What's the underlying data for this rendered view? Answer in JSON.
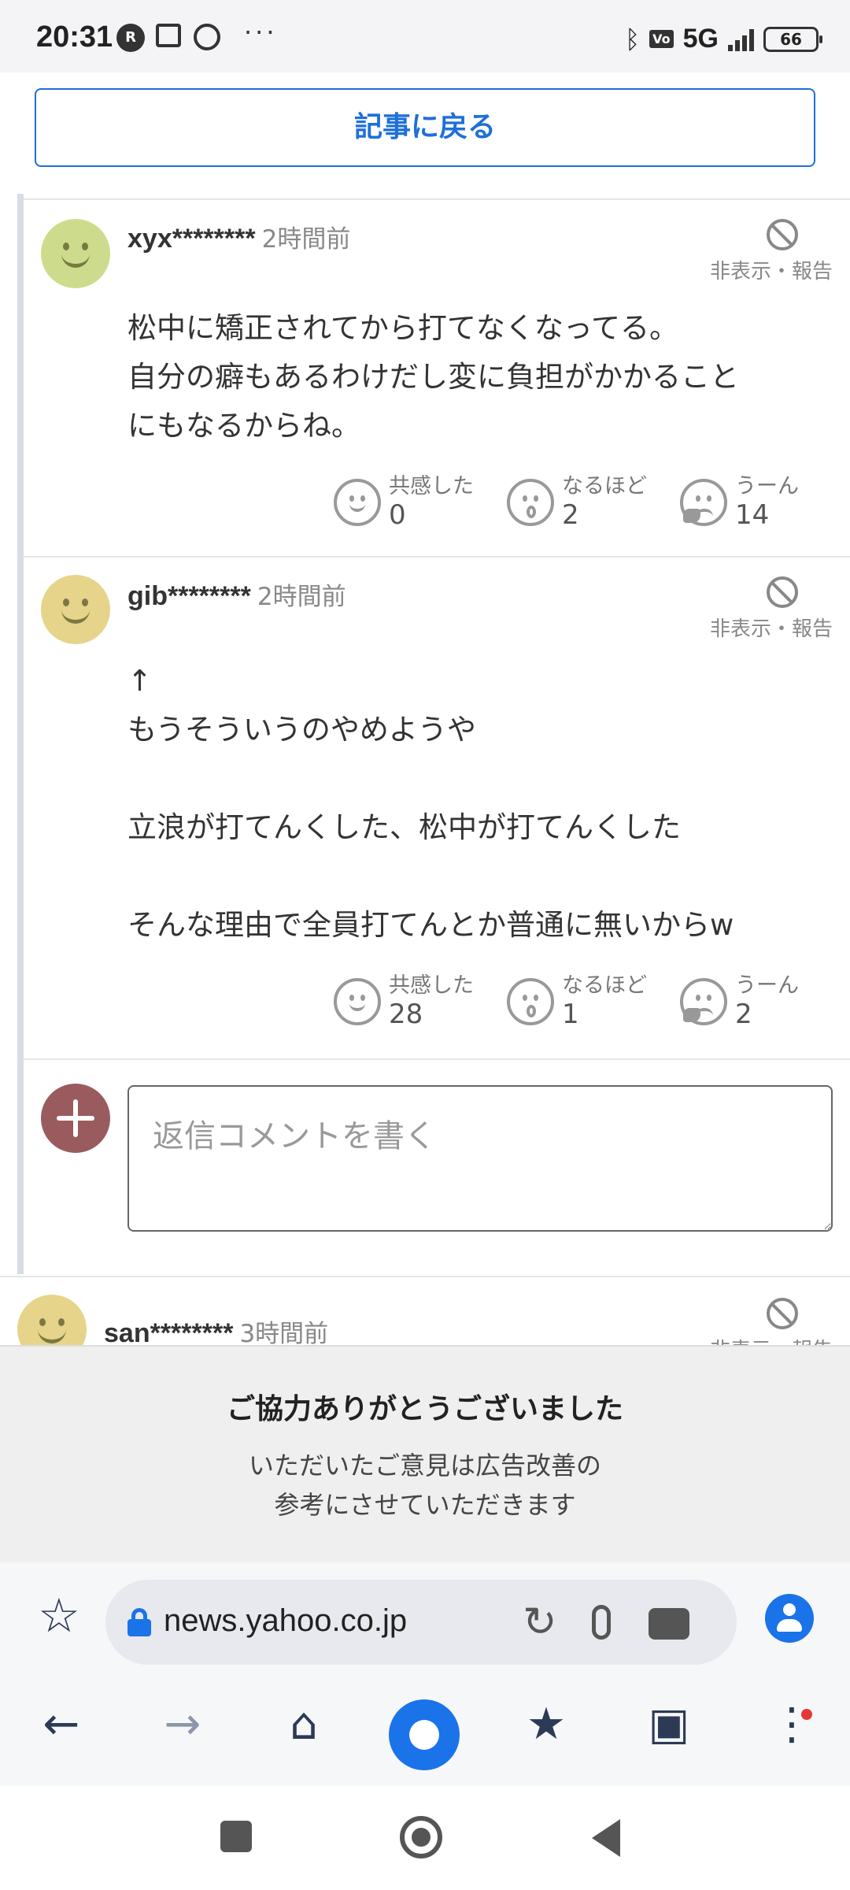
{
  "status_bar": {
    "time": "20:31",
    "network": "5G",
    "battery": "66",
    "icons": [
      "rakuten-link-icon",
      "news-icon",
      "globe-icon",
      "bluetooth-icon",
      "volte-icon",
      "signal-icon",
      "battery-icon"
    ],
    "more": "···"
  },
  "back_button": {
    "label": "記事に戻る"
  },
  "comments": [
    {
      "user": "xyx********",
      "time": "2時間前",
      "avatar_color": "#cddc8c",
      "hide_label": "非表示・報告",
      "body": "松中に矯正されてから打てなくなってる。\n自分の癖もあるわけだし変に負担がかかること\nにもなるからね。",
      "reactions": [
        {
          "label": "共感した",
          "count": "0"
        },
        {
          "label": "なるほど",
          "count": "2"
        },
        {
          "label": "うーん",
          "count": "14"
        }
      ]
    },
    {
      "user": "gib********",
      "time": "2時間前",
      "avatar_color": "#e6d48a",
      "hide_label": "非表示・報告",
      "body": "↑\nもうそういうのやめようや\n\n立浪が打てんくした、松中が打てんくした\n\nそんな理由で全員打てんとか普通に無いからw",
      "reactions": [
        {
          "label": "共感した",
          "count": "28"
        },
        {
          "label": "なるほど",
          "count": "1"
        },
        {
          "label": "うーん",
          "count": "2"
        }
      ]
    },
    {
      "user": "san********",
      "time": "3時間前",
      "avatar_color": "#e6d48a",
      "hide_label": "非表示・報告"
    }
  ],
  "reply": {
    "placeholder": "返信コメントを書く"
  },
  "thanks_panel": {
    "title": "ご協力ありがとうございました",
    "body": "いただいたご意見は広告改善の\n参考にさせていただきます"
  },
  "browser": {
    "url": "news.yahoo.co.jp",
    "accent": "#1a73e8",
    "toolbar_icons": [
      "back-arrow-icon",
      "forward-arrow-icon",
      "home-icon",
      "center-home-icon",
      "bookmarks-icon",
      "tabs-icon",
      "menu-icon"
    ]
  },
  "system_nav": [
    "recents-icon",
    "home-icon",
    "back-icon"
  ]
}
